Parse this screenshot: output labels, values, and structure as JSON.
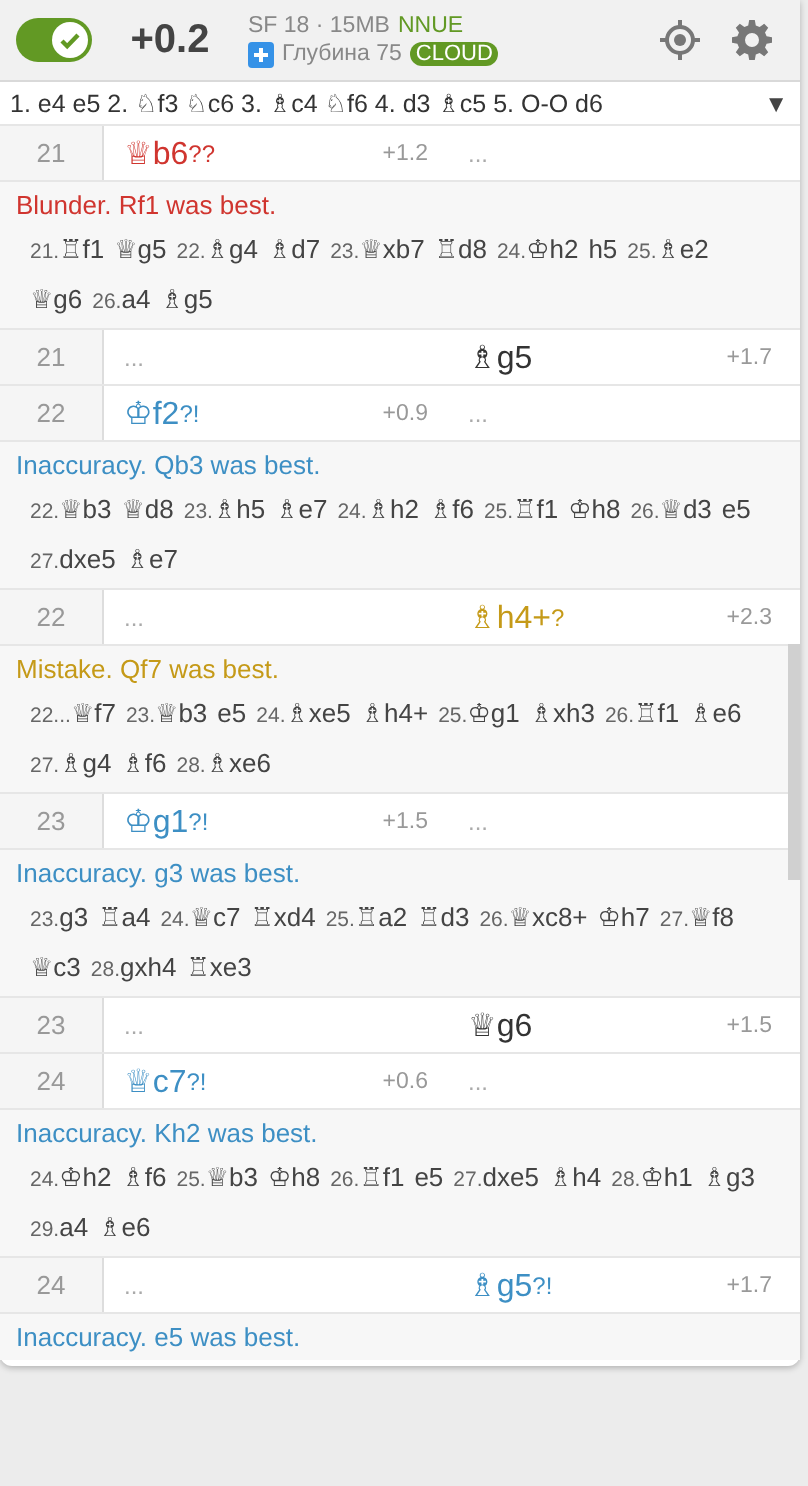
{
  "header": {
    "engine_on": true,
    "eval": "+0.2",
    "engine": "SF 18 · 15MB",
    "engine_tag": "NNUE",
    "depth": "Глубина 75",
    "source": "CLOUD"
  },
  "opening": {
    "moves": "1. e4 e5 2. ♘f3 ♘c6 3. ♗c4 ♘f6 4. d3 ♗c5 5. O-O d6",
    "caret": "▼"
  },
  "blocks": [
    {
      "kind": "row",
      "index": "21",
      "cells": [
        {
          "kind": "move",
          "san": "♕b6",
          "glyph": "??",
          "eval": "+1.2",
          "color": "#d0352f"
        },
        {
          "kind": "ellipsis",
          "text": "..."
        }
      ]
    },
    {
      "kind": "comment",
      "color": "#d0352f",
      "text": "Blunder. Rf1 was best.",
      "line": [
        {
          "num": "21.",
          "san": "♖f1"
        },
        {
          "san": "♕g5"
        },
        {
          "num": "22.",
          "san": "♗g4"
        },
        {
          "san": "♗d7"
        },
        {
          "num": "23.",
          "san": "♕xb7"
        },
        {
          "san": "♖d8"
        },
        {
          "num": "24.",
          "san": "♔h2"
        },
        {
          "san": "h5"
        },
        {
          "num": "25.",
          "san": "♗e2"
        },
        {
          "san": "♕g6"
        },
        {
          "num": "26.",
          "san": "a4"
        },
        {
          "san": "♗g5"
        }
      ]
    },
    {
      "kind": "row",
      "index": "21",
      "cells": [
        {
          "kind": "ellipsis",
          "text": "..."
        },
        {
          "kind": "move",
          "san": "♗g5",
          "eval": "+1.7"
        }
      ]
    },
    {
      "kind": "row",
      "index": "22",
      "cells": [
        {
          "kind": "move",
          "san": "♔f2",
          "glyph": "?!",
          "eval": "+0.9",
          "color": "#3d8fc4"
        },
        {
          "kind": "ellipsis",
          "text": "..."
        }
      ]
    },
    {
      "kind": "comment",
      "color": "#3d8fc4",
      "text": "Inaccuracy. Qb3 was best.",
      "line": [
        {
          "num": "22.",
          "san": "♕b3"
        },
        {
          "san": "♕d8"
        },
        {
          "num": "23.",
          "san": "♗h5"
        },
        {
          "san": "♗e7"
        },
        {
          "num": "24.",
          "san": "♗h2"
        },
        {
          "san": "♗f6"
        },
        {
          "num": "25.",
          "san": "♖f1"
        },
        {
          "san": "♔h8"
        },
        {
          "num": "26.",
          "san": "♕d3"
        },
        {
          "san": "e5"
        },
        {
          "num": "27.",
          "san": "dxe5"
        },
        {
          "san": "♗e7"
        }
      ]
    },
    {
      "kind": "row",
      "index": "22",
      "cells": [
        {
          "kind": "ellipsis",
          "text": "..."
        },
        {
          "kind": "move",
          "san": "♗h4+",
          "glyph": "?",
          "eval": "+2.3",
          "color": "#c59a18"
        }
      ]
    },
    {
      "kind": "comment",
      "color": "#c59a18",
      "text": "Mistake. Qf7 was best.",
      "line": [
        {
          "num": "22...",
          "san": "♕f7"
        },
        {
          "num": "23.",
          "san": "♕b3"
        },
        {
          "san": "e5"
        },
        {
          "num": "24.",
          "san": "♗xe5"
        },
        {
          "san": "♗h4+"
        },
        {
          "num": "25.",
          "san": "♔g1"
        },
        {
          "san": "♗xh3"
        },
        {
          "num": "26.",
          "san": "♖f1"
        },
        {
          "san": "♗e6"
        },
        {
          "num": "27.",
          "san": "♗g4"
        },
        {
          "san": "♗f6"
        },
        {
          "num": "28.",
          "san": "♗xe6"
        }
      ]
    },
    {
      "kind": "row",
      "index": "23",
      "cells": [
        {
          "kind": "move",
          "san": "♔g1",
          "glyph": "?!",
          "eval": "+1.5",
          "color": "#3d8fc4"
        },
        {
          "kind": "ellipsis",
          "text": "..."
        }
      ]
    },
    {
      "kind": "comment",
      "color": "#3d8fc4",
      "text": "Inaccuracy. g3 was best.",
      "line": [
        {
          "num": "23.",
          "san": "g3"
        },
        {
          "san": "♖a4"
        },
        {
          "num": "24.",
          "san": "♕c7"
        },
        {
          "san": "♖xd4"
        },
        {
          "num": "25.",
          "san": "♖a2"
        },
        {
          "san": "♖d3"
        },
        {
          "num": "26.",
          "san": "♕xc8+"
        },
        {
          "san": "♔h7"
        },
        {
          "num": "27.",
          "san": "♕f8"
        },
        {
          "san": "♕c3"
        },
        {
          "num": "28.",
          "san": "gxh4"
        },
        {
          "san": "♖xe3"
        }
      ]
    },
    {
      "kind": "row",
      "index": "23",
      "cells": [
        {
          "kind": "ellipsis",
          "text": "..."
        },
        {
          "kind": "move",
          "san": "♕g6",
          "eval": "+1.5"
        }
      ]
    },
    {
      "kind": "row",
      "index": "24",
      "cells": [
        {
          "kind": "move",
          "san": "♕c7",
          "glyph": "?!",
          "eval": "+0.6",
          "color": "#3d8fc4"
        },
        {
          "kind": "ellipsis",
          "text": "..."
        }
      ]
    },
    {
      "kind": "comment",
      "color": "#3d8fc4",
      "text": "Inaccuracy. Kh2 was best.",
      "line": [
        {
          "num": "24.",
          "san": "♔h2"
        },
        {
          "san": "♗f6"
        },
        {
          "num": "25.",
          "san": "♕b3"
        },
        {
          "san": "♔h8"
        },
        {
          "num": "26.",
          "san": "♖f1"
        },
        {
          "san": "e5"
        },
        {
          "num": "27.",
          "san": "dxe5"
        },
        {
          "san": "♗h4"
        },
        {
          "num": "28.",
          "san": "♔h1"
        },
        {
          "san": "♗g3"
        },
        {
          "num": "29.",
          "san": "a4"
        },
        {
          "san": "♗e6"
        }
      ]
    },
    {
      "kind": "row",
      "index": "24",
      "cells": [
        {
          "kind": "ellipsis",
          "text": "..."
        },
        {
          "kind": "move",
          "san": "♗g5",
          "glyph": "?!",
          "eval": "+1.7",
          "color": "#3d8fc4"
        }
      ]
    },
    {
      "kind": "comment",
      "color": "#3d8fc4",
      "text": "Inaccuracy. e5 was best."
    }
  ]
}
